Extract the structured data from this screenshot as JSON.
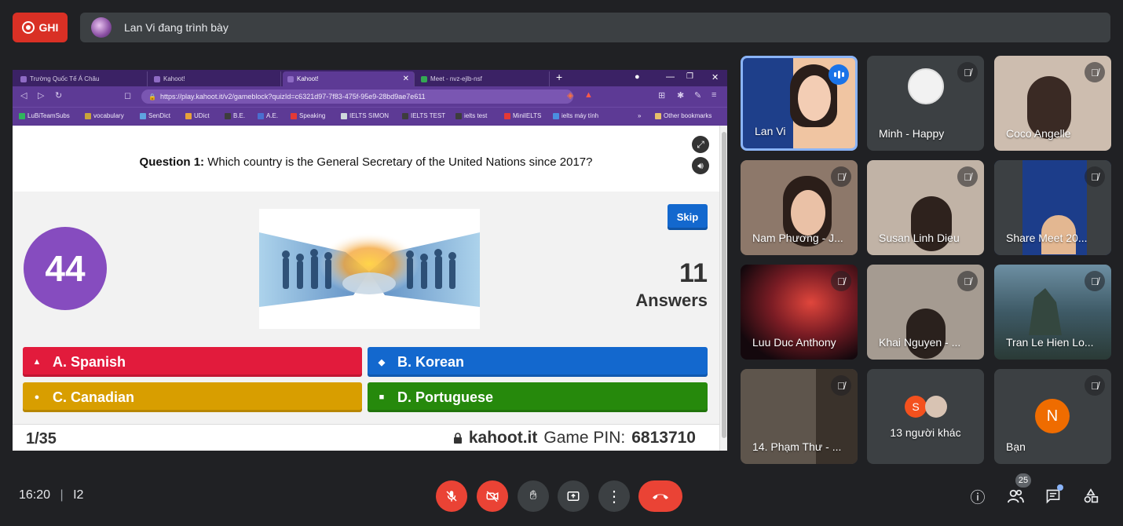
{
  "top_bar": {
    "record_label": "GHI",
    "presenter_text": "Lan Vi đang trình bày"
  },
  "browser": {
    "tabs": [
      {
        "label": "Trường Quốc Tế Á Châu"
      },
      {
        "label": "Kahoot!"
      },
      {
        "label": "Kahoot!"
      },
      {
        "label": "Meet - nvz-ejlb-nsf"
      }
    ],
    "new_tab_glyph": "+",
    "url": "https://play.kahoot.it/v2/gameblock?quizId=c6321d97-7f83-475f-95e9-28bd9ae7e611",
    "bookmarks": [
      "LuBiTeamSubs",
      "vocabulary",
      "SenDict",
      "UDict",
      "B.E.",
      "A.E.",
      "Speaking",
      "IELTS SIMON",
      "IELTS TEST",
      "ielts test",
      "MiniIELTS",
      "ielts máy tính",
      "Other bookmarks"
    ],
    "bookmarks_more": "»"
  },
  "kahoot": {
    "question_prefix": "Question 1:",
    "question_text": " Which country is the General Secretary of the United Nations since 2017?",
    "timer": "44",
    "skip_label": "Skip",
    "answers_count": "11",
    "answers_label": "Answers",
    "answers": [
      {
        "label": "A. Spanish",
        "color": "#e21b3c",
        "symbol": "▲"
      },
      {
        "label": "B. Korean",
        "color": "#1368ce",
        "symbol": "◆"
      },
      {
        "label": "C. Canadian",
        "color": "#d89e00",
        "symbol": "●"
      },
      {
        "label": "D. Portuguese",
        "color": "#26890c",
        "symbol": "■"
      }
    ],
    "progress": "1/35",
    "site": "kahoot.it",
    "pin_label": "Game PIN:",
    "pin": "6813710"
  },
  "participants": [
    {
      "name": "Lan Vi",
      "speaking": true,
      "bg": "#f4c9a8"
    },
    {
      "name": "Minh - Happy",
      "speaking": false,
      "bg": "#3c4043"
    },
    {
      "name": "Coco Angelle",
      "speaking": false,
      "bg": "#c9b8a8"
    },
    {
      "name": "Nam Phương - J...",
      "speaking": false,
      "bg": "#8f7a6a"
    },
    {
      "name": "Susan Linh Dieu",
      "speaking": false,
      "bg": "#b7a89b"
    },
    {
      "name": "Share Meet 20...",
      "speaking": false,
      "bg": "#1c3d8a"
    },
    {
      "name": "Luu Duc Anthony",
      "speaking": false,
      "bg": "#7a1c24"
    },
    {
      "name": "Khai Nguyen - ...",
      "speaking": false,
      "bg": "#9e958c"
    },
    {
      "name": "Tran Le Hien Lo...",
      "speaking": false,
      "bg": "#4c6a78"
    },
    {
      "name": "14. Phạm Thư - ...",
      "speaking": false,
      "bg": "#5b524a"
    },
    {
      "name": "13 người khác",
      "speaking": false,
      "bg": "#3c4043"
    },
    {
      "name": "Bạn",
      "speaking": false,
      "bg": "#3c4043"
    }
  ],
  "others_avatar_letter": "S",
  "you_avatar_letter": "N",
  "bottom_bar": {
    "time": "16:20",
    "separator": "|",
    "meeting_code": "I2",
    "people_count": "25"
  },
  "colors": {
    "meet_bg": "#202124",
    "tile_bg": "#3c4043",
    "kahoot_purple": "#864cbf",
    "danger": "#ea4335",
    "accent_blue": "#8ab4f8"
  }
}
